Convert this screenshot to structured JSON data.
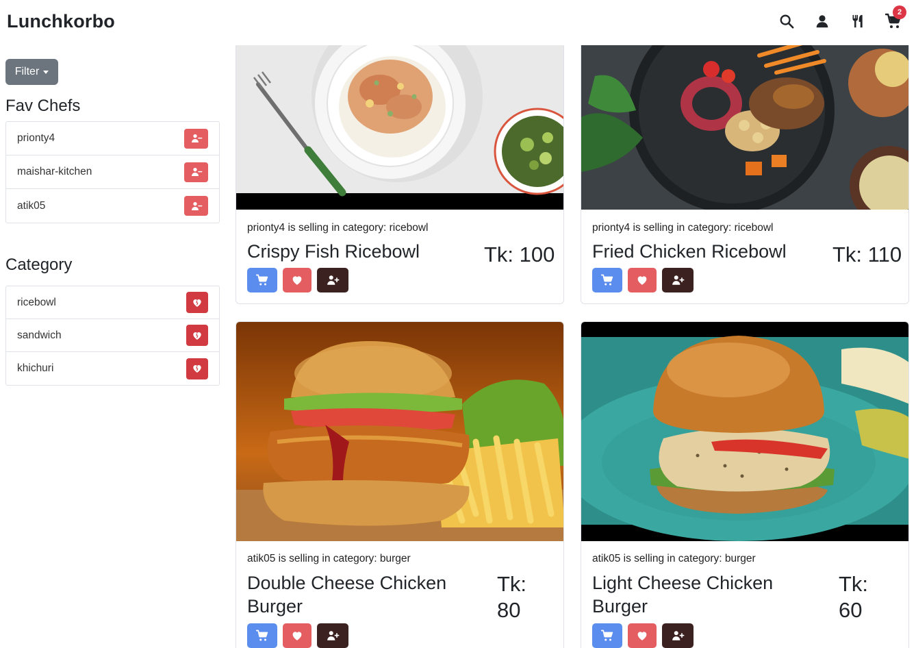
{
  "header": {
    "brand": "Lunchkorbo",
    "cart_count": "2",
    "icons": [
      "search-icon",
      "user-icon",
      "utensils-icon",
      "cart-icon"
    ]
  },
  "sidebar": {
    "filter_label": "Filter",
    "fav_chefs_title": "Fav Chefs",
    "fav_chefs": [
      "prionty4",
      "maishar-kitchen",
      "atik05"
    ],
    "category_title": "Category",
    "categories": [
      "ricebowl",
      "sandwich",
      "khichuri"
    ]
  },
  "products": [
    {
      "seller_line": "prionty4 is selling in category: ricebowl",
      "name": "Crispy Fish Ricebowl",
      "price": "Tk: 100"
    },
    {
      "seller_line": "prionty4 is selling in category: ricebowl",
      "name": "Fried Chicken Ricebowl",
      "price": "Tk: 110"
    },
    {
      "seller_line": "atik05 is selling in category: burger",
      "name_line1": "Double Cheese Chicken",
      "name_line2": "Burger",
      "price_line1": "Tk:",
      "price_line2": "80"
    },
    {
      "seller_line": "atik05 is selling in category: burger",
      "name_line1": "Light Cheese Chicken",
      "name_line2": "Burger",
      "price_line1": "Tk:",
      "price_line2": "60"
    }
  ],
  "colors": {
    "filter_button": "#6c757d",
    "unfollow_button": "#e35d61",
    "unfav_button": "#d13a41",
    "cart_button": "#5b8def",
    "fav_button": "#e35d61",
    "follow_button": "#3c2121",
    "badge": "#dc3545"
  }
}
